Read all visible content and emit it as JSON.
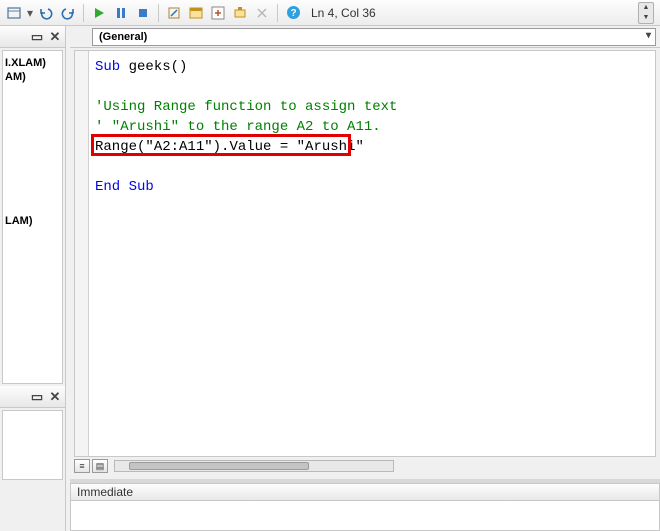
{
  "toolbar": {
    "status": "Ln 4, Col 36"
  },
  "left": {
    "tree_items": [
      "I.XLAM)",
      "AM)",
      "LAM)"
    ]
  },
  "combo": {
    "general": "(General)"
  },
  "code": {
    "l1a": "Sub",
    "l1b": " geeks()",
    "l2": "",
    "l3": "'Using Range function to assign text",
    "l4": "' \"Arushi\" to the range A2 to A11.",
    "l5a": "Range(",
    "l5b": "\"A2:A11\"",
    "l5c": ").Value = ",
    "l5d": "\"Arushi\"",
    "l6": "",
    "l7": "End Sub"
  },
  "immediate": {
    "title": "Immediate"
  }
}
